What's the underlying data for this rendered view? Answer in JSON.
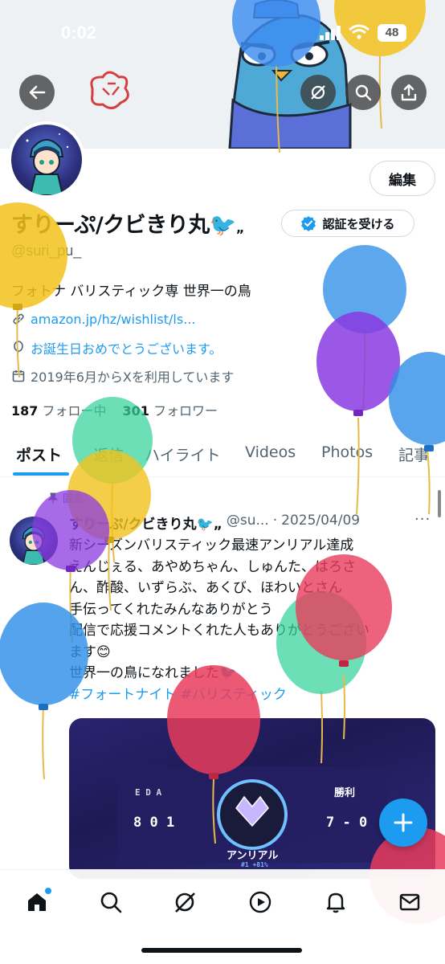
{
  "status_bar": {
    "time": "0:02",
    "battery": "48"
  },
  "header": {
    "back_label": "back",
    "search_label": "search",
    "share_label": "share"
  },
  "profile": {
    "edit_label": "編集",
    "name": "すりーぷ/クビきり丸🐦",
    "name_suffix": "„",
    "verify_label": "認証を受ける",
    "handle": "@suri_pu_",
    "bio": "フォトナ バリスティック専 世界一の鳥",
    "link": "amazon.jp/hz/wishlist/ls...",
    "birthday": "お誕生日おめでとうございます。",
    "joined": "2019年6月からXを利用しています",
    "following_count": "187",
    "following_label": "フォロー中",
    "followers_count": "301",
    "followers_label": "フォロワー"
  },
  "tabs": [
    {
      "label": "ポスト"
    },
    {
      "label": "返信"
    },
    {
      "label": "ハイライト"
    },
    {
      "label": "Videos"
    },
    {
      "label": "Photos"
    },
    {
      "label": "記事"
    }
  ],
  "post": {
    "pinned_label": "固定",
    "author": "すりーぷ/クビきり丸🐦„",
    "handle": "@su...",
    "dot": "·",
    "date": "2025/04/09",
    "more": "···",
    "lines": [
      "新シーズンバリスティック最速アンリアル達成",
      "えんじぇる、あやめちゃん、しゅんた、はろさ",
      "ん、酢酸、いずらぶ、あくび、ほわいとさん",
      "手伝ってくれたみんなありがとう",
      "配信で応援コメントくれた人もありがとうござい",
      "ます😊",
      "世界一の鳥になれました🐦"
    ],
    "hashtags": "#フォートナイト #バリスティック",
    "media": {
      "left_label": "E D A",
      "left_value": "8 0 1",
      "right_label": "勝利",
      "right_value": "7 - 0",
      "rank_label": "アンリアル",
      "rank_sub": "#1 +81%"
    }
  },
  "nav": [
    "home-icon",
    "search-icon",
    "grok-icon",
    "video-icon",
    "notifications-icon",
    "messages-icon"
  ],
  "colors": {
    "accent": "#1d9bf0",
    "text": "#0f1419",
    "muted": "#536471"
  }
}
